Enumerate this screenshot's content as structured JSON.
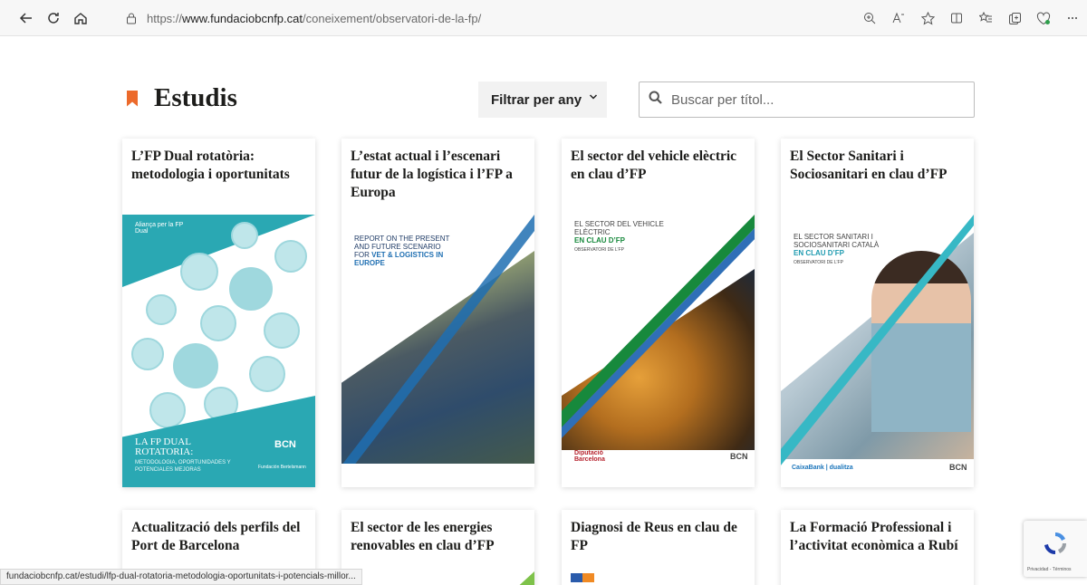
{
  "browser": {
    "url_prefix": "https://",
    "url_domain": "www.fundaciobcnfp.cat",
    "url_path": "/coneixement/observatori-de-la-fp/",
    "status_url": "fundaciobcnfp.cat/estudi/lfp-dual-rotatoria-metodologia-oportunitats-i-potencials-millor..."
  },
  "page": {
    "title": "Estudis",
    "filter_label": "Filtrar per any",
    "search_placeholder": "Buscar per títol..."
  },
  "colors": {
    "accent": "#ec6a2b"
  },
  "cards": [
    {
      "title": "L’FP Dual rotatòria: metodologia i oportunitats",
      "cover_brand": "Aliança per la FP Dual",
      "cover_title": "LA FP DUAL ROTATORIA:",
      "cover_subtitle": "METODOLOGIA, OPORTUNIDADES Y POTENCIALES MEJORAS",
      "cover_logo": "BCN",
      "cover_logo2": "Fundación Bertelsmann"
    },
    {
      "title": "L’estat actual i l’escenari futur de la logística i l’FP a Europa",
      "cover_line1": "REPORT ON THE PRESENT AND FUTURE SCENARIO FOR",
      "cover_highlight": "VET & LOGISTICS IN EUROPE"
    },
    {
      "title": "El sector del vehicle elèctric en clau d’FP",
      "cover_line1": "EL SECTOR DEL VEHICLE ELÈCTRIC",
      "cover_highlight": "EN CLAU D’FP",
      "cover_sub": "OBSERVATORI DE L’FP",
      "cover_logo": "Diputació Barcelona",
      "cover_logo2": "BCN"
    },
    {
      "title": "El Sector Sanitari i Sociosanitari en clau d’FP",
      "cover_line1": "EL SECTOR SANITARI I SOCIOSANITARI CATALÀ",
      "cover_highlight": "EN CLAU D’FP",
      "cover_sub": "OBSERVATORI DE L’FP",
      "cover_logo": "CaixaBank | dualitza",
      "cover_logo2": "BCN"
    },
    {
      "title": "Actualització dels perfils del Port de Barcelona"
    },
    {
      "title": "El sector de les energies renovables en clau d’FP"
    },
    {
      "title": "Diagnosi de Reus en clau de FP"
    },
    {
      "title": "La Formació Professional i l’activitat econòmica a Rubí"
    }
  ],
  "recaptcha": {
    "text": "Privacidad - Términos"
  }
}
